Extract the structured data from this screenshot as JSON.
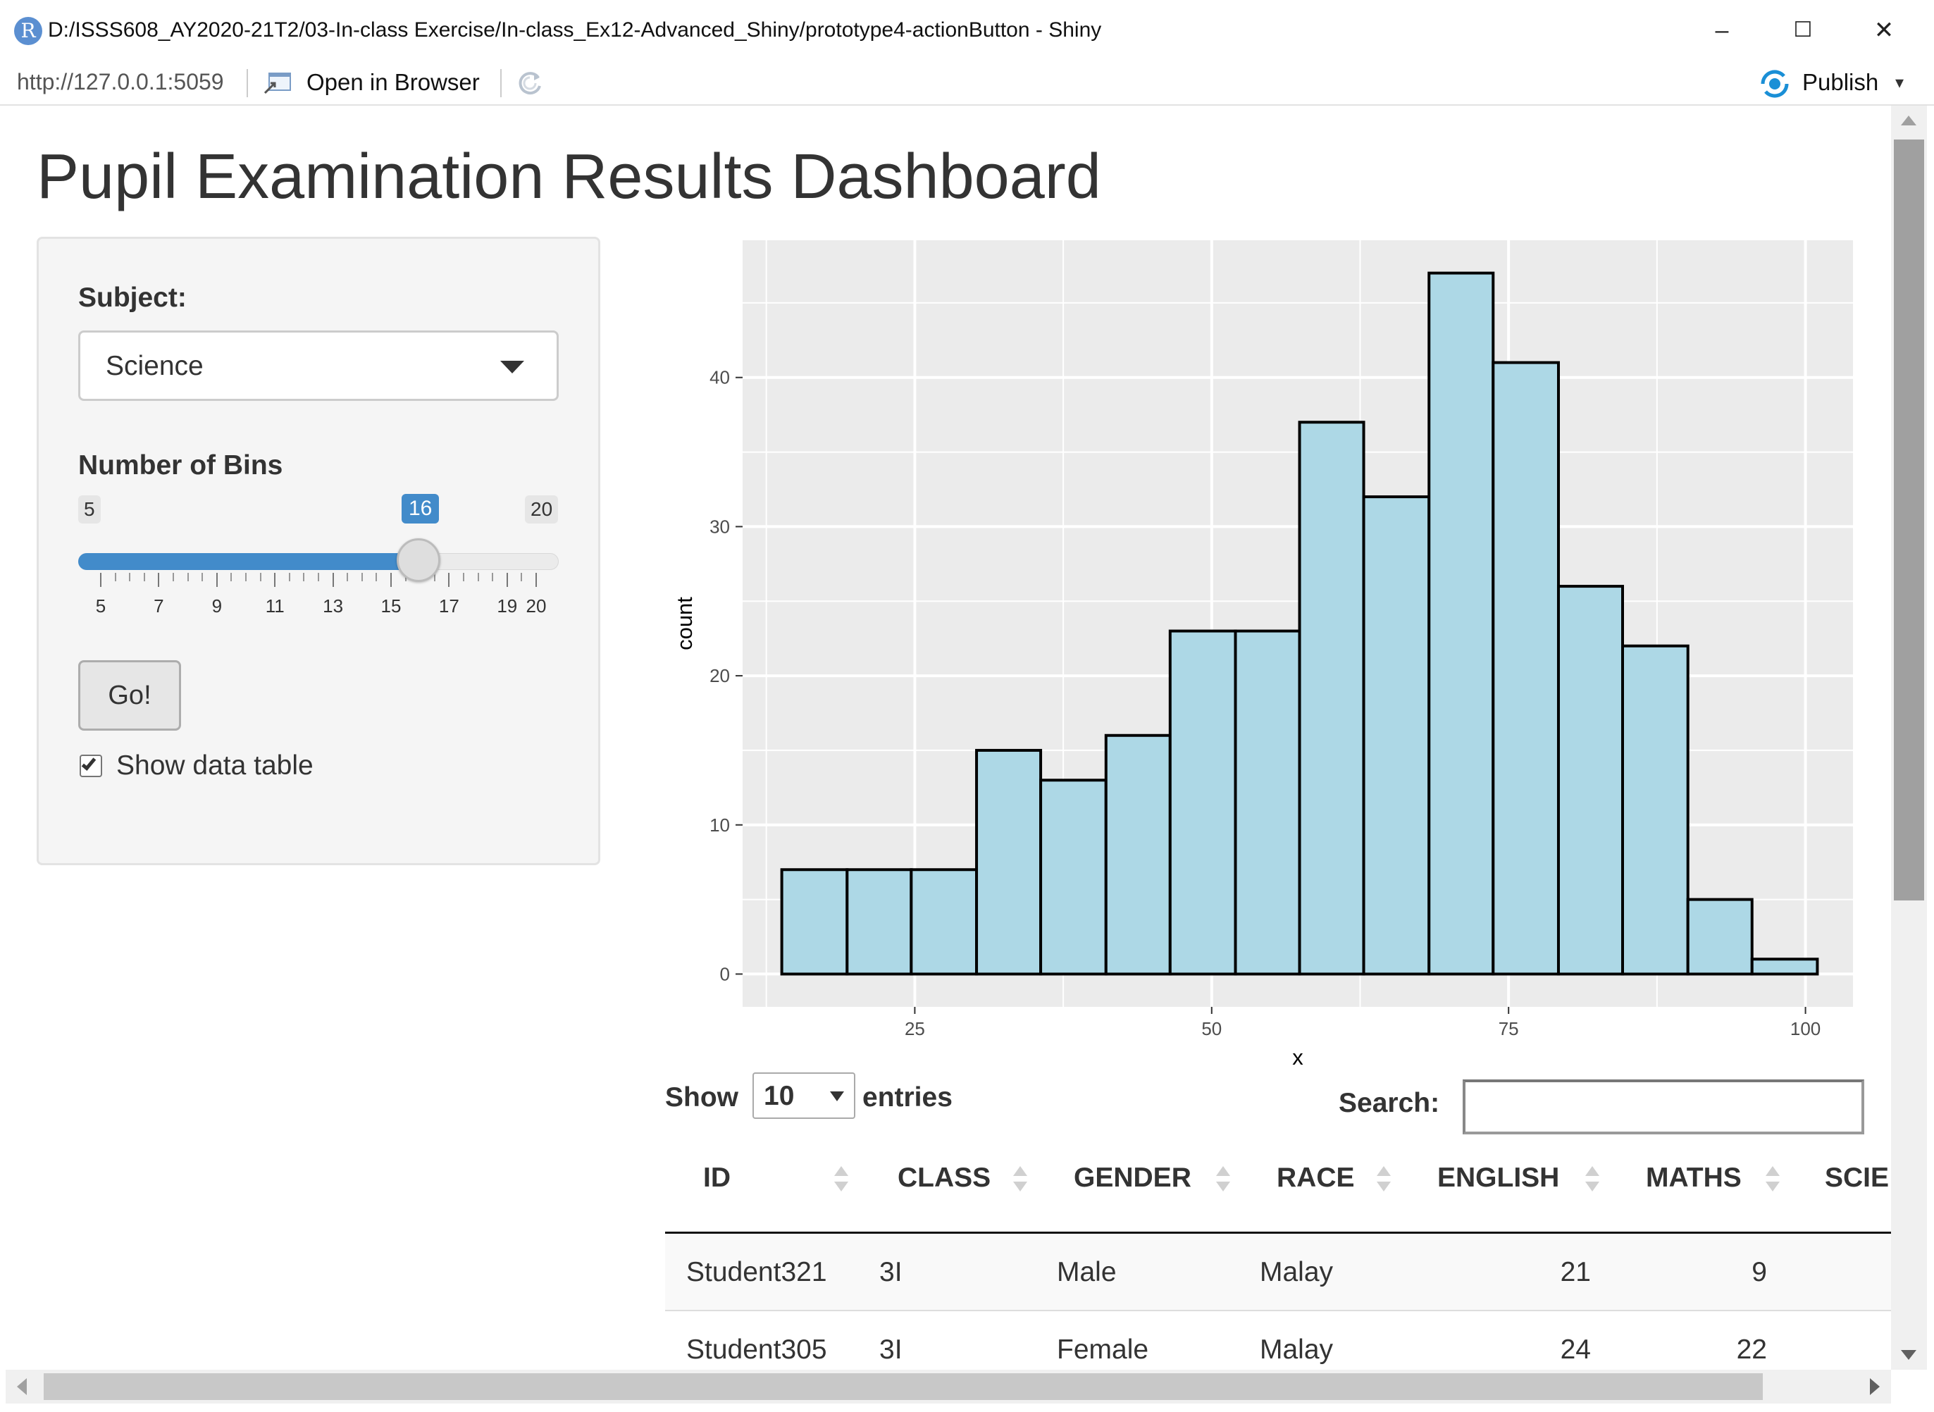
{
  "window": {
    "app_icon_letter": "R",
    "title": "D:/ISSS608_AY2020-21T2/03-In-class Exercise/In-class_Ex12-Advanced_Shiny/prototype4-actionButton - Shiny",
    "minimize": "–",
    "maximize": "☐",
    "close": "✕"
  },
  "toolbar": {
    "url": "http://127.0.0.1:5059",
    "open_in_browser": "Open in Browser",
    "publish": "Publish",
    "publish_caret": "▾"
  },
  "page": {
    "title": "Pupil Examination Results Dashboard"
  },
  "sidebar": {
    "subject_label": "Subject:",
    "subject_value": "Science",
    "bins_label": "Number of Bins",
    "slider": {
      "min": 5,
      "max": 20,
      "value": 16,
      "min_label": "5",
      "max_label": "20",
      "value_label": "16",
      "tick_labels": [
        "5",
        "7",
        "9",
        "11",
        "13",
        "15",
        "17",
        "19",
        "20"
      ]
    },
    "go_button": "Go!",
    "show_table_label": "Show data table",
    "show_table_checked": true
  },
  "chart_data": {
    "type": "bar",
    "title": "",
    "xlabel": "x",
    "ylabel": "count",
    "bin_edges": [
      13.8,
      19.3,
      24.7,
      30.2,
      35.6,
      41.1,
      46.5,
      52.0,
      57.4,
      62.8,
      68.3,
      73.7,
      79.2,
      84.6,
      90.1,
      95.5,
      101.0
    ],
    "values": [
      7,
      7,
      7,
      15,
      13,
      16,
      23,
      23,
      37,
      32,
      47,
      41,
      26,
      22,
      5,
      1
    ],
    "xlim": [
      10.5,
      104.0
    ],
    "ylim": [
      -2.2,
      49.2
    ],
    "x_ticks": [
      25,
      50,
      75,
      100
    ],
    "y_ticks": [
      0,
      10,
      20,
      30,
      40
    ],
    "bar_fill": "#add8e6",
    "bar_stroke": "#000000",
    "panel_bg": "#ebebeb",
    "grid": true
  },
  "table": {
    "show_label": "Show",
    "length_value": "10",
    "entries_label": "entries",
    "search_label": "Search:",
    "search_value": "",
    "columns": [
      "ID",
      "CLASS",
      "GENDER",
      "RACE",
      "ENGLISH",
      "MATHS",
      "SCIE"
    ],
    "rows": [
      [
        "Student321",
        "3I",
        "Male",
        "Malay",
        "21",
        "9"
      ],
      [
        "Student305",
        "3I",
        "Female",
        "Malay",
        "24",
        "22"
      ]
    ]
  }
}
